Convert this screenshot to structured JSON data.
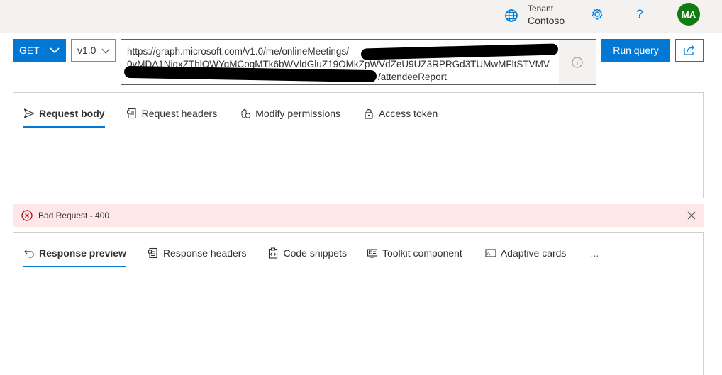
{
  "header": {
    "tenant_label": "Tenant",
    "tenant_name": "Contoso",
    "avatar_initials": "MA",
    "icons": [
      "globe-icon",
      "gear-icon",
      "help-icon"
    ]
  },
  "query": {
    "method": "GET",
    "version": "v1.0",
    "url_line1": "https://graph.microsoft.com/v1.0/me/onlineMeetings/",
    "url_line2": "0yMDA1NjgxZThlOWYqMCoqMTk6bWVldGluZ19OMkZpWVdZeU9UZ3RPRGd3TUMwMFltSTVMV",
    "url_line3": "/attendeeReport",
    "run_label": "Run query"
  },
  "request_tabs": [
    {
      "label": "Request body",
      "icon": "send-icon"
    },
    {
      "label": "Request headers",
      "icon": "headers-icon"
    },
    {
      "label": "Modify permissions",
      "icon": "permissions-icon"
    },
    {
      "label": "Access token",
      "icon": "lock-icon"
    }
  ],
  "error": {
    "message": "Bad Request - 400"
  },
  "response_tabs": [
    {
      "label": "Response preview",
      "icon": "back-arrow-icon"
    },
    {
      "label": "Response headers",
      "icon": "headers-icon"
    },
    {
      "label": "Code snippets",
      "icon": "clipboard-icon"
    },
    {
      "label": "Toolkit component",
      "icon": "toolkit-icon"
    },
    {
      "label": "Adaptive cards",
      "icon": "card-icon"
    },
    {
      "label": "...",
      "icon": "more-icon"
    }
  ],
  "colors": {
    "accent": "#0078d4",
    "error_bg": "#fde7e9",
    "avatar_bg": "#107c10"
  }
}
